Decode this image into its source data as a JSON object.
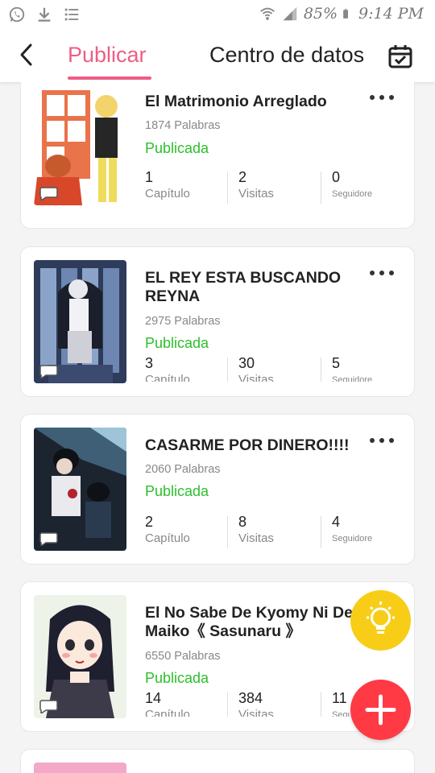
{
  "status_bar": {
    "battery": "85%",
    "time": "9:14 PM"
  },
  "header": {
    "tab_active": "Publicar",
    "tab_other": "Centro de datos"
  },
  "works": [
    {
      "title": "El Matrimonio Arreglado",
      "words": "1874 Palabras",
      "status": "Publicada",
      "chapters_num": "1",
      "chapters_label": "Capítulo",
      "visits_num": "2",
      "visits_label": "Visitas",
      "followers_num": "0",
      "followers_label": "Seguidore"
    },
    {
      "title": "EL REY ESTA BUSCANDO REYNA",
      "words": "2975 Palabras",
      "status": "Publicada",
      "chapters_num": "3",
      "chapters_label": "Capítulo",
      "visits_num": "30",
      "visits_label": "Visitas",
      "followers_num": "5",
      "followers_label": "Seguidore"
    },
    {
      "title": "CASARME POR DINERO!!!!",
      "words": "2060 Palabras",
      "status": "Publicada",
      "chapters_num": "2",
      "chapters_label": "Capítulo",
      "visits_num": "8",
      "visits_label": "Visitas",
      "followers_num": "4",
      "followers_label": "Seguidore"
    },
    {
      "title": "El No Sabe De Kyomy Ni De Maiko《 Sasunaru 》",
      "words": "6550 Palabras",
      "status": "Publicada",
      "chapters_num": "14",
      "chapters_label": "Capítulo",
      "visits_num": "384",
      "visits_label": "Visitas",
      "followers_num": "11",
      "followers_label": "Seguidore"
    }
  ],
  "colors": {
    "accent": "#ef5d84",
    "published": "#2cbf2c",
    "tip_fab": "#f8cd18",
    "add_fab": "#ff3a45"
  },
  "icons": {
    "back": "chevron-left-icon",
    "calendar": "calendar-check-icon",
    "more": "more-dots-icon",
    "tip": "lightbulb-icon",
    "add": "plus-icon",
    "comment": "chat-bubble-icon"
  }
}
